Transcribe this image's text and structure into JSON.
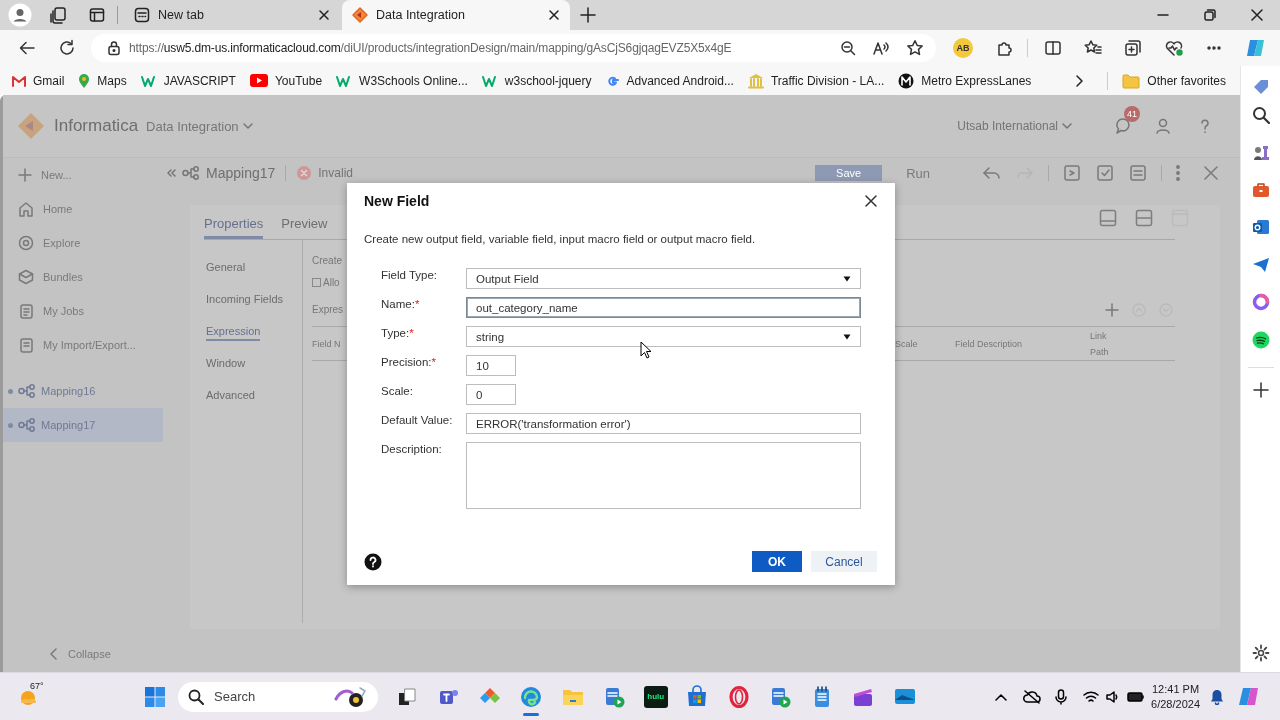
{
  "browser": {
    "tabs": [
      {
        "title": "New tab",
        "selected": false
      },
      {
        "title": "Data Integration",
        "selected": true
      }
    ],
    "address": {
      "scheme": "https://",
      "host": "usw5.dm-us.informaticacloud.com",
      "path": "/diUI/products/integrationDesign/main/mapping/gAsCjS6gjqagEVZ5X5x4gE"
    },
    "profile_badge": "AB",
    "bookmarks": [
      {
        "label": "Gmail"
      },
      {
        "label": "Maps"
      },
      {
        "label": "JAVASCRIPT"
      },
      {
        "label": "YouTube"
      },
      {
        "label": "W3Schools Online..."
      },
      {
        "label": "w3school-jquery"
      },
      {
        "label": "Advanced Android..."
      },
      {
        "label": "Traffic Division - LA..."
      },
      {
        "label": "Metro ExpressLanes"
      }
    ],
    "other_favorites": "Other favorites"
  },
  "app": {
    "brand": "Informatica",
    "product": "Data Integration",
    "org": "Utsab International",
    "notification_count": "41",
    "nav": [
      {
        "label": "New..."
      },
      {
        "label": "Home"
      },
      {
        "label": "Explore"
      },
      {
        "label": "Bundles"
      },
      {
        "label": "My Jobs"
      },
      {
        "label": "My Import/Export..."
      }
    ],
    "open_items": [
      {
        "label": "Mapping16",
        "selected": false
      },
      {
        "label": "Mapping17",
        "selected": true
      }
    ],
    "collapse": "Collapse",
    "mapping_title": "Mapping17",
    "status": "Invalid",
    "save": "Save",
    "run": "Run",
    "tabs": [
      {
        "label": "Properties",
        "selected": true
      },
      {
        "label": "Preview",
        "selected": false
      }
    ],
    "sections": [
      {
        "label": "General",
        "selected": false
      },
      {
        "label": "Incoming Fields",
        "selected": false
      },
      {
        "label": "Expression",
        "selected": true
      },
      {
        "label": "Window",
        "selected": false
      },
      {
        "label": "Advanced",
        "selected": false
      }
    ],
    "create_text": "Create",
    "allow_text": "Allo",
    "allow_checked": false,
    "expressions_text": "Expres",
    "table_columns": [
      "Field N",
      "Scale",
      "Field Description",
      "Link Path"
    ]
  },
  "dialog": {
    "title": "New Field",
    "description": "Create new output field, variable field, input macro field or output macro field.",
    "fields": [
      {
        "label": "Field Type:",
        "kind": "select",
        "value": "Output Field",
        "focused": false
      },
      {
        "label": "Name:",
        "required_mark": "*",
        "kind": "text",
        "value": "out_category_name",
        "focused": true
      },
      {
        "label": "Type:",
        "required_mark": "*",
        "kind": "select",
        "value": "string",
        "focused": false
      },
      {
        "label": "Precision:",
        "required_mark": "*",
        "kind": "short",
        "value": "10",
        "focused": false
      },
      {
        "label": "Scale:",
        "kind": "short",
        "value": "0",
        "focused": false
      },
      {
        "label": "Default Value:",
        "kind": "text",
        "value": "ERROR('transformation error')",
        "focused": false
      },
      {
        "label": "Description:",
        "kind": "textarea",
        "focused": false
      }
    ],
    "ok": "OK",
    "cancel": "Cancel"
  },
  "taskbar": {
    "weather": "67°",
    "search_placeholder": "Search",
    "hulu": "hulu",
    "time": "12:41 PM",
    "date": "6/28/2024"
  }
}
